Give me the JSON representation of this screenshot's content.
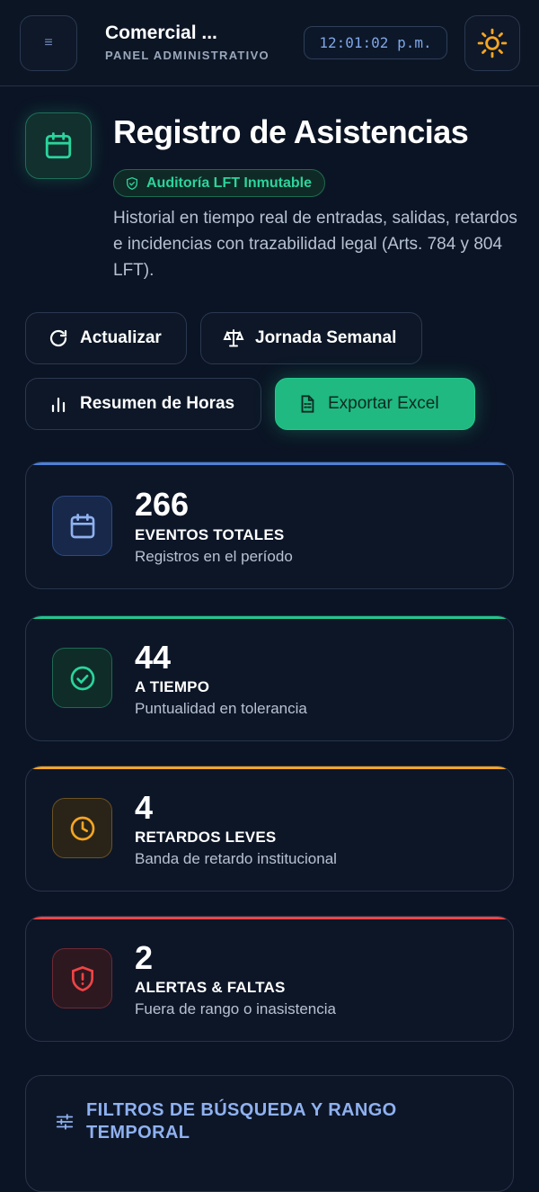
{
  "header": {
    "brand_title": "Comercial ...",
    "brand_subtitle": "PANEL ADMINISTRATIVO",
    "clock": "12:01:02 p.m.",
    "menu_icon": "hamburger-icon",
    "theme_icon": "sun-icon"
  },
  "page": {
    "title": "Registro de Asistencias",
    "badge": "Auditoría LFT Inmutable",
    "description": "Historial en tiempo real de entradas, salidas, retardos e incidencias con trazabilidad legal (Arts. 784 y 804 LFT).",
    "icon": "calendar-icon"
  },
  "actions": {
    "refresh": "Actualizar",
    "weekly": "Jornada Semanal",
    "hours": "Resumen de Horas",
    "export": "Exportar Excel"
  },
  "stats": [
    {
      "value": "266",
      "label": "EVENTOS TOTALES",
      "sub": "Registros en el período",
      "color": "#4f7fd6",
      "icon": "calendar-icon"
    },
    {
      "value": "44",
      "label": "A TIEMPO",
      "sub": "Puntualidad en tolerancia",
      "color": "#22c58c",
      "icon": "check-circle-icon"
    },
    {
      "value": "4",
      "label": "RETARDOS LEVES",
      "sub": "Banda de retardo institucional",
      "color": "#f5a524",
      "icon": "clock-icon"
    },
    {
      "value": "2",
      "label": "ALERTAS & FALTAS",
      "sub": "Fuera de rango o inasistencia",
      "color": "#ef4444",
      "icon": "shield-alert-icon"
    }
  ],
  "filters": {
    "title": "FILTROS DE BÚSQUEDA Y RANGO TEMPORAL",
    "icon": "sliders-icon"
  },
  "colors": {
    "background": "#0b1424",
    "accent_green": "#1fb981",
    "accent_blue": "#4f7fd6",
    "accent_amber": "#f5a524",
    "accent_red": "#ef4444"
  }
}
